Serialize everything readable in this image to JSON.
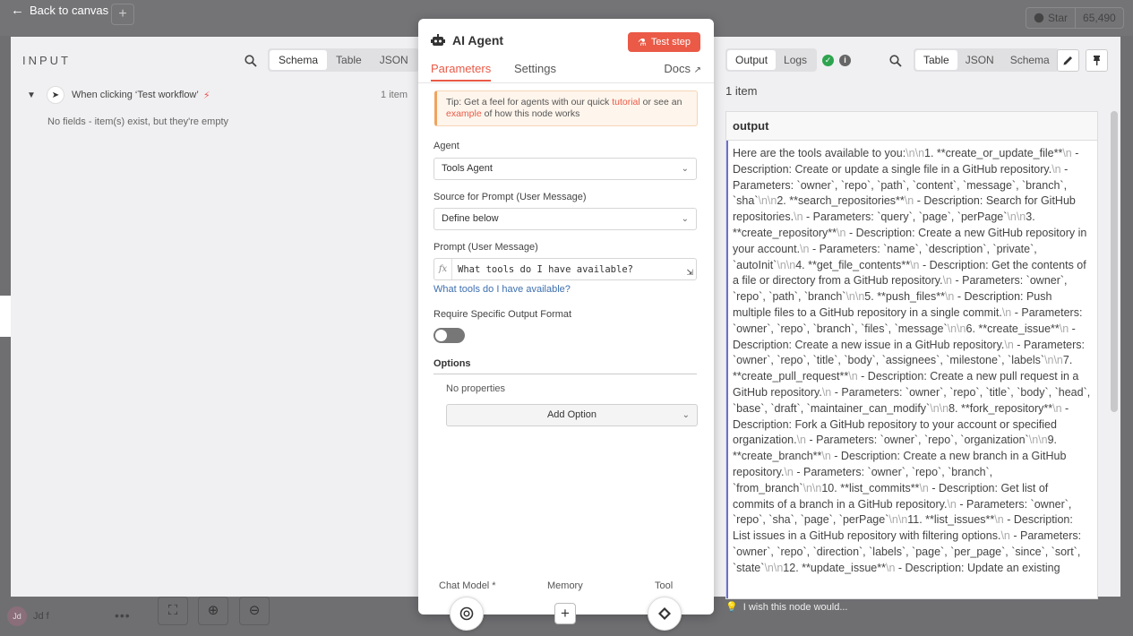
{
  "background": {
    "back_label": "Back to canvas",
    "github_star_label": "Star",
    "github_star_count": "65,490",
    "user_initials": "Jd",
    "user_name": "Jd f"
  },
  "input_panel": {
    "title": "INPUT",
    "view_modes": [
      "Schema",
      "Table",
      "JSON"
    ],
    "active_view": "Schema",
    "trigger_name": "When clicking ‘Test workflow’",
    "trigger_count": "1 item",
    "empty_message": "No fields - item(s) exist, but they're empty"
  },
  "node": {
    "title": "AI Agent",
    "test_button": "Test step",
    "tabs": [
      "Parameters",
      "Settings"
    ],
    "active_tab": "Parameters",
    "docs_label": "Docs",
    "tip": {
      "prefix": "Tip: Get a feel for agents with our quick ",
      "link1": "tutorial",
      "middle": " or see an ",
      "link2": "example",
      "suffix": " of how this node works"
    },
    "agent_label": "Agent",
    "agent_value": "Tools Agent",
    "source_label": "Source for Prompt (User Message)",
    "source_value": "Define below",
    "prompt_label": "Prompt (User Message)",
    "prompt_value": "What tools do I have available?",
    "prompt_preview": "What tools do I have available?",
    "require_format_label": "Require Specific Output Format",
    "require_format_on": false,
    "options_label": "Options",
    "no_properties": "No properties",
    "add_option": "Add Option",
    "sub_nodes": [
      "Chat Model *",
      "Memory",
      "Tool"
    ]
  },
  "output_panel": {
    "modes": [
      "Output",
      "Logs"
    ],
    "active_mode": "Output",
    "view_modes": [
      "Table",
      "JSON",
      "Schema"
    ],
    "active_view": "Table",
    "item_count": "1 item",
    "column_header": "output",
    "cell_segments": [
      "Here are the tools available to you:",
      "\\n\\n",
      "1. **create_or_update_file**",
      "\\n",
      " - Description: Create or update a single file in a GitHub repository.",
      "\\n",
      "   - Parameters: `owner`, `repo`, `path`, `content`, `message`, `branch`, `sha`",
      "\\n\\n",
      "2. **search_repositories**",
      "\\n",
      "   - Description: Search for GitHub repositories.",
      "\\n",
      "   - Parameters: `query`, `page`, `perPage`",
      "\\n\\n",
      "3. **create_repository**",
      "\\n",
      "   - Description: Create a new GitHub repository in your account.",
      "\\n",
      "   - Parameters: `name`, `description`, `private`, `autoInit`",
      "\\n\\n",
      "4. **get_file_contents**",
      "\\n",
      "   - Description: Get the contents of a file or directory from a GitHub repository.",
      "\\n",
      "   - Parameters: `owner`, `repo`, `path`, `branch`",
      "\\n\\n",
      "5. **push_files**",
      "\\n",
      "   - Description: Push multiple files to a GitHub repository in a single commit.",
      "\\n",
      "   - Parameters: `owner`, `repo`, `branch`, `files`, `message`",
      "\\n\\n",
      "6. **create_issue**",
      "\\n",
      "   - Description: Create a new issue in a GitHub repository.",
      "\\n",
      "   - Parameters: `owner`, `repo`, `title`, `body`, `assignees`, `milestone`, `labels`",
      "\\n\\n",
      "7. **create_pull_request**",
      "\\n",
      "   - Description: Create a new pull request in a GitHub repository.",
      "\\n",
      "   - Parameters: `owner`, `repo`, `title`, `body`, `head`, `base`, `draft`, `maintainer_can_modify`",
      "\\n\\n",
      "8. **fork_repository**",
      "\\n",
      "   - Description: Fork a GitHub repository to your account or specified organization.",
      "\\n",
      "   - Parameters: `owner`, `repo`, `organization`",
      "\\n\\n",
      "9. **create_branch**",
      "\\n",
      " - Description: Create a new branch in a GitHub repository.",
      "\\n",
      "   - Parameters: `owner`, `repo`, `branch`, `from_branch`",
      "\\n\\n",
      "10. **list_commits**",
      "\\n",
      "   - Description: Get list of commits of a branch in a GitHub repository.",
      "\\n",
      "   - Parameters: `owner`, `repo`, `sha`, `page`, `perPage`",
      "\\n\\n",
      "11. **list_issues**",
      "\\n",
      "   - Description: List issues in a GitHub repository with filtering options.",
      "\\n",
      "   - Parameters: `owner`, `repo`, `direction`, `labels`, `page`, `per_page`, `since`, `sort`, `state`",
      "\\n\\n",
      "12. **update_issue**",
      "\\n",
      "   - Description: Update an existing"
    ],
    "feedback_placeholder": "I wish this node would..."
  }
}
